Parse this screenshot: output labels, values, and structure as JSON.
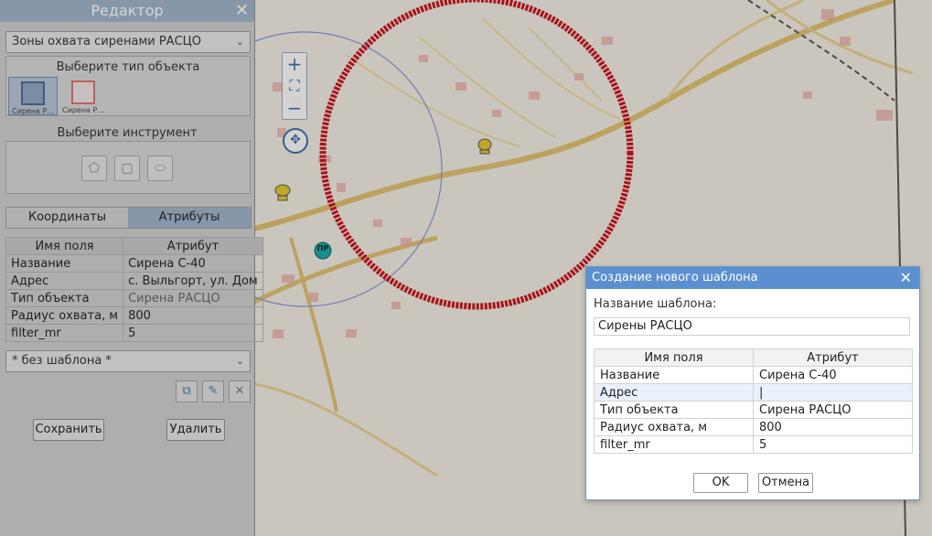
{
  "editor": {
    "title": "Редактор",
    "layer_select": "Зоны охвата сиренами РАСЦО",
    "object_type_label": "Выберите тип объекта",
    "object_types": [
      {
        "label": "Сирена Р...",
        "color": "#4a6c94"
      },
      {
        "label": "Сирена Р...",
        "color": "#e0726b"
      }
    ],
    "tool_label": "Выберите инструмент",
    "tabs": [
      "Координаты",
      "Атрибуты"
    ],
    "table_headers": [
      "Имя поля",
      "Атрибут"
    ],
    "attributes": [
      {
        "name": "Название",
        "value": "Сирена С-40"
      },
      {
        "name": "Адрес",
        "value": "с. Выльгорт, ул. Дом"
      },
      {
        "name": "Тип объекта",
        "value": "Сирена РАСЦО"
      },
      {
        "name": "Радиус охвата, м",
        "value": "800"
      },
      {
        "name": "filter_mr",
        "value": "5"
      }
    ],
    "template_select": "* без шаблона *",
    "save_label": "Сохранить",
    "delete_label": "Удалить"
  },
  "map": {
    "marker_label": "ПР",
    "coverage_color": "#c8111b"
  },
  "dialog": {
    "title": "Создание нового шаблона",
    "name_label": "Название шаблона:",
    "name_value": "Сирены РАСЦО",
    "table_headers": [
      "Имя поля",
      "Атрибут"
    ],
    "rows": [
      {
        "name": "Название",
        "value": "Сирена С-40"
      },
      {
        "name": "Адрес",
        "value": "|"
      },
      {
        "name": "Тип объекта",
        "value": "Сирена РАСЦО"
      },
      {
        "name": "Радиус охвата, м",
        "value": "800"
      },
      {
        "name": "filter_mr",
        "value": "5"
      }
    ],
    "ok_label": "OK",
    "cancel_label": "Отмена"
  }
}
